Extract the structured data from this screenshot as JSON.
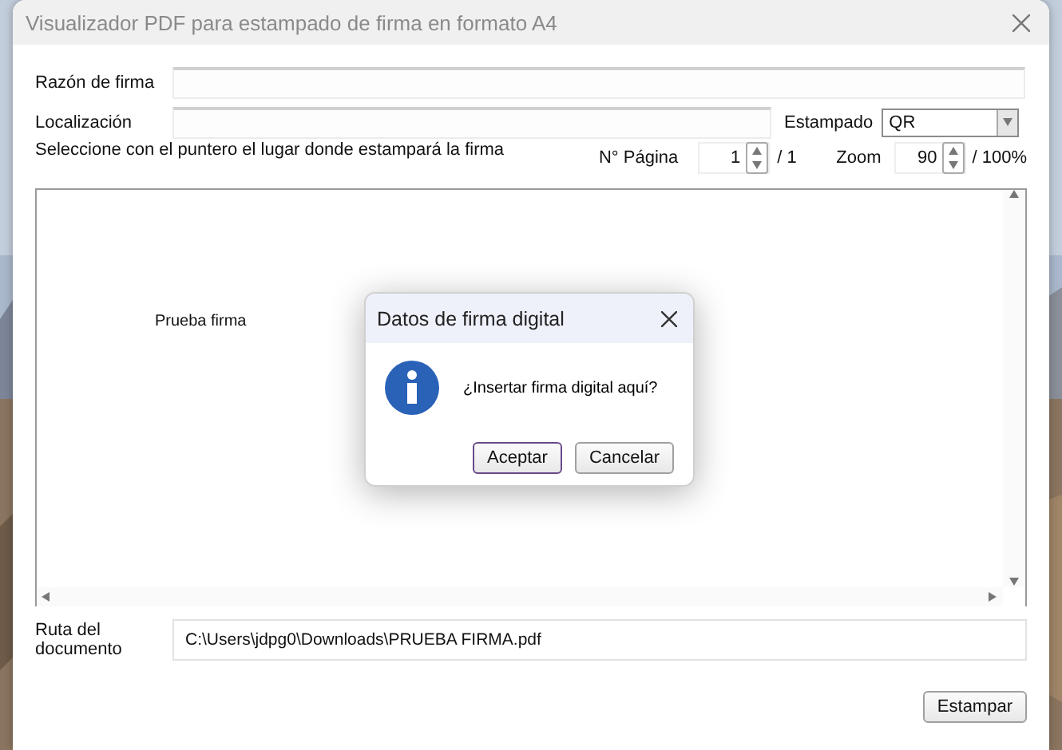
{
  "window": {
    "title": "Visualizador PDF para estampado de firma en formato A4"
  },
  "reason": {
    "label": "Razón de firma"
  },
  "location": {
    "label": "Localización"
  },
  "stamp": {
    "label": "Estampado",
    "value": "QR"
  },
  "instruction": "Seleccione con el puntero el lugar donde estampará la firma",
  "page": {
    "label": "N° Página",
    "value": "1",
    "total": "/ 1"
  },
  "zoom": {
    "label": "Zoom",
    "value": "90",
    "suffix": "/ 100%"
  },
  "document": {
    "text": "Prueba firma"
  },
  "path": {
    "label": "Ruta del documento",
    "value": "C:\\Users\\jdpg0\\Downloads\\PRUEBA FIRMA.pdf"
  },
  "stamp_button": "Estampar",
  "dialog": {
    "title": "Datos de firma digital",
    "message": "¿Insertar firma digital aquí?",
    "buttons": [
      {
        "label": "Aceptar",
        "default": true
      },
      {
        "label": "Cancelar",
        "default": false
      }
    ]
  }
}
